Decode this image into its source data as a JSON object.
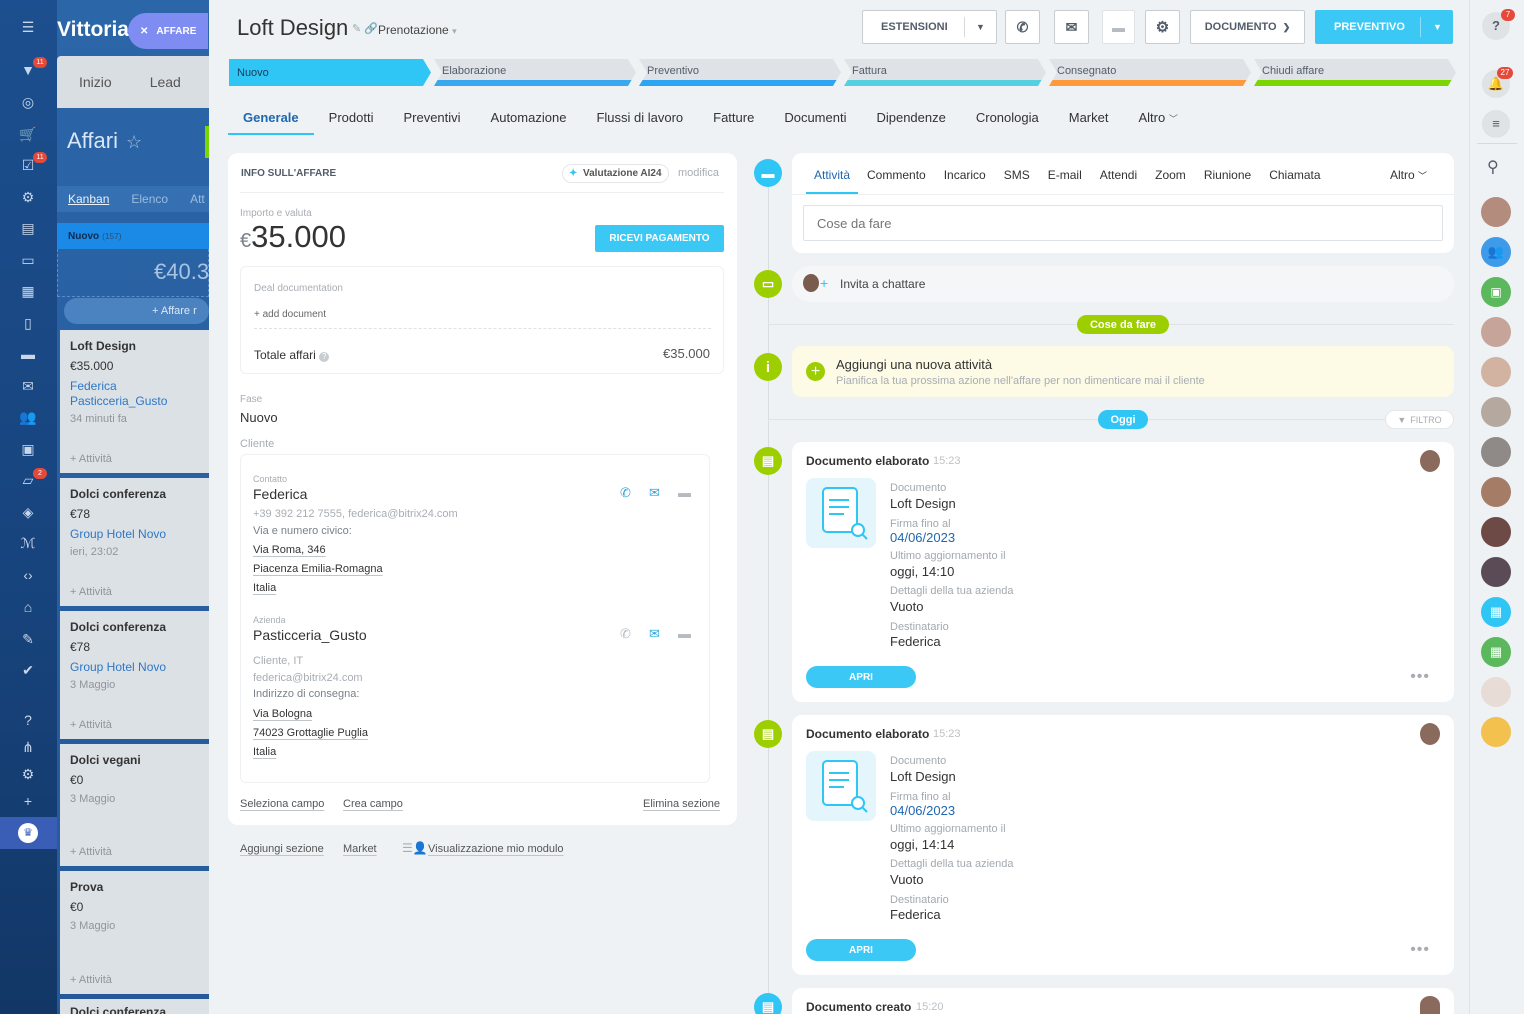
{
  "rail": {
    "badges": [
      "11",
      "11",
      "2"
    ]
  },
  "background": {
    "user_name": "Vittoria",
    "add_deal_button": "AFFARE",
    "nav": [
      "Inizio",
      "Lead"
    ],
    "section_title": "Affari",
    "views": [
      "Kanban",
      "Elenco",
      "Att"
    ],
    "stage_name": "Nuovo",
    "stage_count": "(157)",
    "stage_sum": "€40.3",
    "add_label": "+ Affare r",
    "cards": [
      {
        "title": "Loft Design",
        "amount": "€35.000",
        "links": [
          "Federica",
          "Pasticceria_Gusto"
        ],
        "meta": "34 minuti fa",
        "activity": "+ Attività"
      },
      {
        "title": "Dolci conferenza",
        "amount": "€78",
        "links": [
          "Group Hotel Novo"
        ],
        "meta": "ieri, 23:02",
        "activity": "+ Attività"
      },
      {
        "title": "Dolci conferenza",
        "amount": "€78",
        "links": [
          "Group Hotel Novo"
        ],
        "meta": "3 Maggio",
        "activity": "+ Attività"
      },
      {
        "title": "Dolci vegani",
        "amount": "€0",
        "links": [],
        "meta": "3 Maggio",
        "activity": "+ Attività"
      },
      {
        "title": "Prova",
        "amount": "€0",
        "links": [],
        "meta": "3 Maggio",
        "activity": "+ Attività"
      },
      {
        "title": "Dolci conferenza",
        "amount": "",
        "links": [],
        "meta": "",
        "activity": ""
      }
    ]
  },
  "header": {
    "title": "Loft Design",
    "category": "Prenotazione",
    "buttons": {
      "extensions": "ESTENSIONI",
      "document": "DOCUMENTO",
      "quote": "PREVENTIVO"
    }
  },
  "stages": [
    {
      "label": "Nuovo",
      "color": "#2fc6f6",
      "active": true
    },
    {
      "label": "Elaborazione",
      "color": "#39a8ef",
      "active": false
    },
    {
      "label": "Preventivo",
      "color": "#2ea5f2",
      "active": false
    },
    {
      "label": "Fattura",
      "color": "#55d0e0",
      "active": false
    },
    {
      "label": "Consegnato",
      "color": "#ff9a3c",
      "active": false
    },
    {
      "label": "Chiudi affare",
      "color": "#7bd500",
      "active": false
    }
  ],
  "tabs": [
    "Generale",
    "Prodotti",
    "Preventivi",
    "Automazione",
    "Flussi di lavoro",
    "Fatture",
    "Documenti",
    "Dipendenze",
    "Cronologia",
    "Market",
    "Altro"
  ],
  "deal_info": {
    "section_title": "INFO SULL'AFFARE",
    "ai_badge": "Valutazione AI24",
    "edit_link": "modifica",
    "amount_label": "Importo e valuta",
    "currency": "€",
    "amount": "35.000",
    "pay_button": "RICEVI PAGAMENTO",
    "doc_label": "Deal documentation",
    "add_document": "+ add document",
    "total_label": "Totale affari",
    "total_value": "€35.000",
    "stage_label": "Fase",
    "stage_value": "Nuovo",
    "client_label": "Cliente",
    "contact": {
      "label": "Contatto",
      "name": "Federica",
      "phone_email": "+39 392 212 7555, federica@bitrix24.com",
      "address_label": "Via e numero civico:",
      "address_lines": [
        "Via Roma, 346",
        "Piacenza Emilia-Romagna",
        "Italia"
      ]
    },
    "company": {
      "label": "Azienda",
      "name": "Pasticceria_Gusto",
      "type": "Cliente, IT",
      "email": "federica@bitrix24.com",
      "address_label": "Indirizzo di consegna:",
      "address_lines": [
        "Via Bologna",
        "74023 Grottaglie Puglia",
        "Italia"
      ]
    },
    "footer": {
      "select_field": "Seleziona campo",
      "create_field": "Crea campo",
      "delete_section": "Elimina sezione"
    }
  },
  "bottom_links": {
    "add_section": "Aggiungi sezione",
    "market": "Market",
    "form_view": "Visualizzazione mio modulo"
  },
  "timeline": {
    "activity_tabs": [
      "Attività",
      "Commento",
      "Incarico",
      "SMS",
      "E-mail",
      "Attendi",
      "Zoom",
      "Riunione",
      "Chiamata"
    ],
    "more_tab": "Altro",
    "todo_placeholder": "Cose da fare",
    "invite_chat": "Invita a chattare",
    "todo_pill": "Cose da fare",
    "new_activity_title": "Aggiungi una nuova attività",
    "new_activity_hint": "Pianifica la tua prossima azione nell'affare per non dimenticare mai il cliente",
    "today_pill": "Oggi",
    "filter": "FILTRO",
    "events": [
      {
        "title": "Documento elaborato",
        "time": "15:23",
        "fields": [
          {
            "label": "Documento",
            "value": "Loft Design",
            "link": false
          },
          {
            "label": "Firma fino al",
            "value": "04/06/2023",
            "link": true
          },
          {
            "label": "Ultimo aggiornamento il",
            "value": "oggi, 14:10",
            "link": false
          },
          {
            "label": "Dettagli della tua azienda",
            "value": "Vuoto",
            "link": false
          },
          {
            "label": "Destinatario",
            "value": "Federica",
            "link": false
          }
        ],
        "open_button": "APRI"
      },
      {
        "title": "Documento elaborato",
        "time": "15:23",
        "fields": [
          {
            "label": "Documento",
            "value": "Loft Design",
            "link": false
          },
          {
            "label": "Firma fino al",
            "value": "04/06/2023",
            "link": true
          },
          {
            "label": "Ultimo aggiornamento il",
            "value": "oggi, 14:14",
            "link": false
          },
          {
            "label": "Dettagli della tua azienda",
            "value": "Vuoto",
            "link": false
          },
          {
            "label": "Destinatario",
            "value": "Federica",
            "link": false
          }
        ],
        "open_button": "APRI"
      },
      {
        "title": "Documento creato",
        "time": "15:20",
        "fields": [],
        "open_button": ""
      }
    ]
  },
  "right_bar": {
    "badges": [
      "7",
      "27"
    ]
  }
}
